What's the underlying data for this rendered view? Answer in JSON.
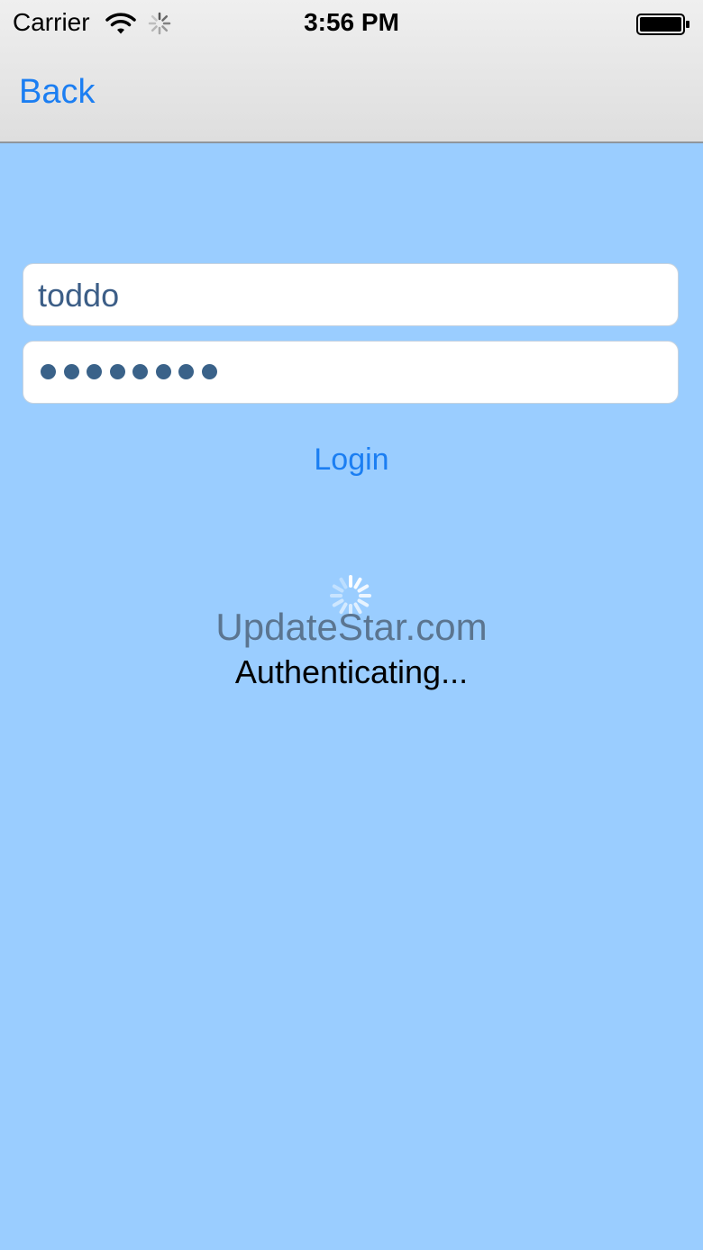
{
  "status_bar": {
    "carrier": "Carrier",
    "time": "3:56 PM"
  },
  "nav": {
    "back_label": "Back"
  },
  "form": {
    "username_value": "toddo",
    "password_length": 8,
    "login_label": "Login"
  },
  "loading": {
    "watermark": "UpdateStar.com",
    "status": "Authenticating..."
  },
  "icons": {
    "wifi": "wifi-icon",
    "activity": "network-activity-icon",
    "battery": "battery-icon",
    "spinner": "loading-spinner-icon"
  },
  "colors": {
    "background": "#9acdff",
    "accent": "#1b7ef2",
    "field_text": "#3c5e87"
  }
}
